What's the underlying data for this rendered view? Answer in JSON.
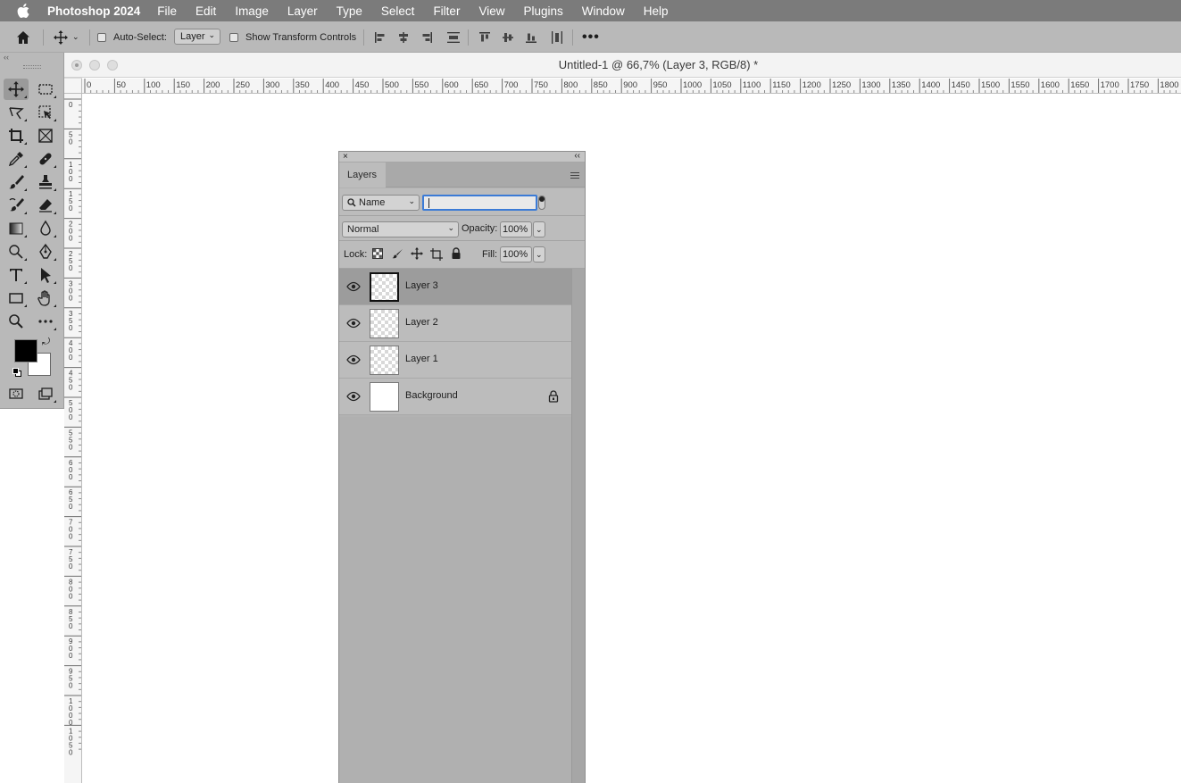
{
  "menubar": {
    "apple_icon": "apple-icon",
    "app_name": "Photoshop 2024",
    "items": [
      "File",
      "Edit",
      "Image",
      "Layer",
      "Type",
      "Select",
      "Filter",
      "View",
      "Plugins",
      "Window",
      "Help"
    ]
  },
  "options_bar": {
    "auto_select_label": "Auto-Select:",
    "auto_select_checked": false,
    "auto_select_target": "Layer",
    "show_transform_label": "Show Transform Controls",
    "show_transform_checked": false,
    "more_icon": "ellipsis-icon"
  },
  "document": {
    "title": "Untitled-1 @ 66,7% (Layer 3, RGB/8) *",
    "ruler_h_labels": [
      "0",
      "50",
      "100",
      "150",
      "200",
      "250",
      "300",
      "350",
      "400",
      "450",
      "500",
      "550",
      "600",
      "650",
      "700",
      "750",
      "800",
      "850",
      "900",
      "950",
      "1000",
      "1050",
      "1100",
      "1150",
      "1200",
      "1250",
      "1300",
      "1350",
      "1400",
      "1450",
      "1500",
      "1550",
      "1600",
      "1650",
      "1700",
      "1750",
      "1800"
    ],
    "ruler_v_labels": [
      "0",
      "50",
      "100",
      "150",
      "200",
      "250",
      "300",
      "350",
      "400",
      "450",
      "500",
      "550",
      "600",
      "650",
      "700",
      "750",
      "800",
      "850",
      "900",
      "950",
      "1000",
      "1050"
    ]
  },
  "layers_panel": {
    "tab_label": "Layers",
    "filter_kind": "Name",
    "filter_text": "",
    "blend_mode": "Normal",
    "opacity_label": "Opacity:",
    "opacity_value": "100%",
    "lock_label": "Lock:",
    "fill_label": "Fill:",
    "fill_value": "100%",
    "layers": [
      {
        "name": "Layer 3",
        "visible": true,
        "selected": true,
        "locked": false
      },
      {
        "name": "Layer 2",
        "visible": true,
        "selected": false,
        "locked": false
      },
      {
        "name": "Layer 1",
        "visible": true,
        "selected": false,
        "locked": false
      },
      {
        "name": "Background",
        "visible": true,
        "selected": false,
        "locked": true
      }
    ]
  },
  "colors": {
    "foreground": "#000000",
    "background": "#ffffff",
    "menubar_bg": "#7b7b7b",
    "panel_bg": "#b2b2b2",
    "selected_layer_bg": "#9c9c9c"
  }
}
